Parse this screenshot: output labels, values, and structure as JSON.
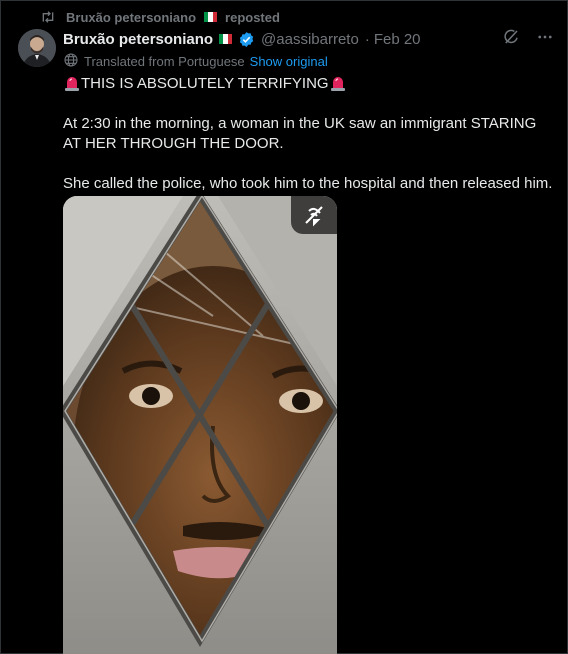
{
  "repost": {
    "name": "Bruxão petersoniano",
    "suffix": "reposted"
  },
  "post": {
    "author_name": "Bruxão petersoniano",
    "handle": "@aassibarreto",
    "separator": "·",
    "date": "Feb 20",
    "translated_label": "Translated from Portuguese",
    "show_original_label": "Show original",
    "headline": "THIS IS ABSOLUTELY TERRIFYING",
    "paragraph_1": "At 2:30 in the morning, a woman in the UK saw an immigrant STARING AT HER THROUGH THE DOOR.",
    "paragraph_2": "She called the police, who took him to the hospital and then released him."
  },
  "colors": {
    "background": "#000000",
    "text": "#e7e9ea",
    "secondary_text": "#71767b",
    "link": "#1d9bf0",
    "verified": "#1d9bf0",
    "siren": "#e0245e"
  },
  "icons": {
    "repost": "repost-icon",
    "verified": "verified-badge-icon",
    "grok": "grok-icon",
    "more": "more-icon",
    "translate": "globe-icon",
    "siren": "police-light-icon",
    "media_action": "no-sound-icon"
  }
}
